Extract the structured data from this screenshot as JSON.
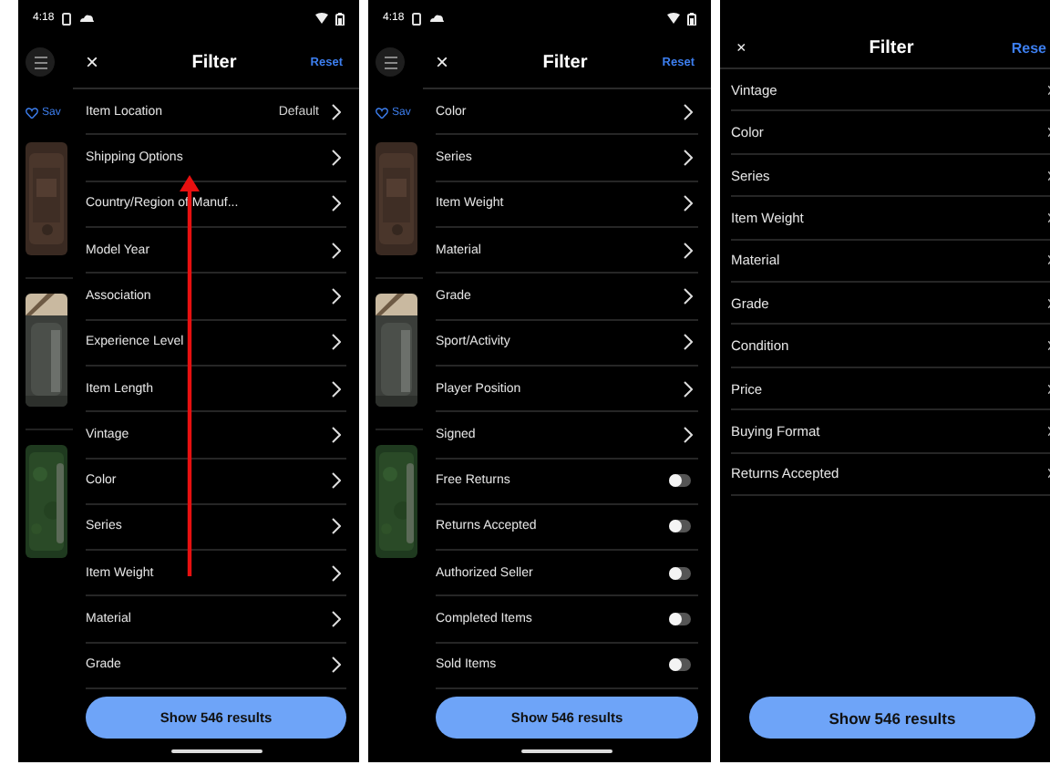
{
  "screens": [
    {
      "status_bar": {
        "time": "4:18"
      },
      "background_app": {
        "save_label": "Sav"
      },
      "header": {
        "close": "×",
        "title": "Filter",
        "reset": "Reset"
      },
      "rows": [
        {
          "kind": "link",
          "label": "Item Location",
          "value": "Default"
        },
        {
          "kind": "link",
          "label": "Shipping Options"
        },
        {
          "kind": "link",
          "label": "Country/Region of Manuf..."
        },
        {
          "kind": "link",
          "label": "Model Year"
        },
        {
          "kind": "link",
          "label": "Association"
        },
        {
          "kind": "link",
          "label": "Experience Level"
        },
        {
          "kind": "link",
          "label": "Item Length"
        },
        {
          "kind": "link",
          "label": "Vintage"
        },
        {
          "kind": "link",
          "label": "Color"
        },
        {
          "kind": "link",
          "label": "Series"
        },
        {
          "kind": "link",
          "label": "Item Weight"
        },
        {
          "kind": "link",
          "label": "Material"
        },
        {
          "kind": "link",
          "label": "Grade"
        }
      ],
      "button": "Show 546 results",
      "home_indicator": true,
      "annotation": {
        "kind": "arrow-up"
      }
    },
    {
      "status_bar": {
        "time": "4:18"
      },
      "background_app": {
        "save_label": "Sav"
      },
      "header": {
        "close": "×",
        "title": "Filter",
        "reset": "Reset"
      },
      "rows": [
        {
          "kind": "link",
          "label": "Color"
        },
        {
          "kind": "link",
          "label": "Series"
        },
        {
          "kind": "link",
          "label": "Item Weight"
        },
        {
          "kind": "link",
          "label": "Material"
        },
        {
          "kind": "link",
          "label": "Grade"
        },
        {
          "kind": "link",
          "label": "Sport/Activity"
        },
        {
          "kind": "link",
          "label": "Player Position"
        },
        {
          "kind": "link",
          "label": "Signed"
        },
        {
          "kind": "toggle",
          "label": "Free Returns",
          "on": false
        },
        {
          "kind": "toggle",
          "label": "Returns Accepted",
          "on": false
        },
        {
          "kind": "toggle",
          "label": "Authorized Seller",
          "on": false
        },
        {
          "kind": "toggle",
          "label": "Completed Items",
          "on": false
        },
        {
          "kind": "toggle",
          "label": "Sold Items",
          "on": false
        }
      ],
      "button": "Show 546 results",
      "home_indicator": true
    },
    {
      "header": {
        "close": "×",
        "title": "Filter",
        "reset": "Rese"
      },
      "rows": [
        {
          "kind": "link",
          "label": "Vintage"
        },
        {
          "kind": "link",
          "label": "Color"
        },
        {
          "kind": "link",
          "label": "Series"
        },
        {
          "kind": "link",
          "label": "Item Weight"
        },
        {
          "kind": "link",
          "label": "Material"
        },
        {
          "kind": "link",
          "label": "Grade"
        },
        {
          "kind": "link",
          "label": "Condition"
        },
        {
          "kind": "link",
          "label": "Price"
        },
        {
          "kind": "link",
          "label": "Buying Format"
        },
        {
          "kind": "link",
          "label": "Returns Accepted"
        }
      ],
      "button": "Show 546 results",
      "home_indicator": false
    }
  ]
}
